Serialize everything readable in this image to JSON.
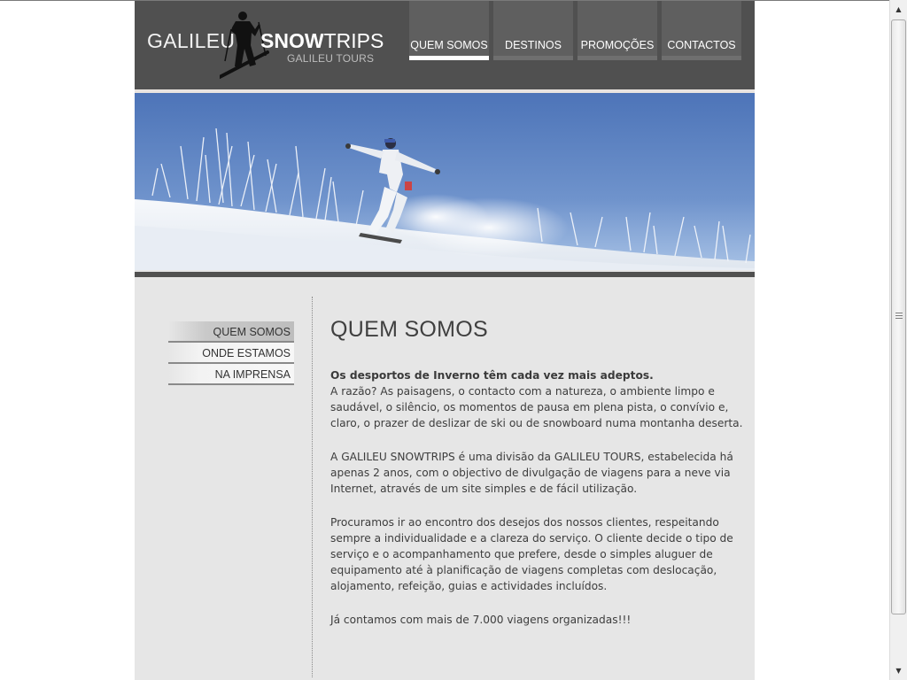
{
  "logo": {
    "word1": "GALILEU",
    "word2_bold": "SNOW",
    "word2_light": "TRIPS",
    "subtitle": "GALILEU TOURS"
  },
  "nav": {
    "items": [
      {
        "label": "QUEM SOMOS",
        "active": true
      },
      {
        "label": "DESTINOS",
        "active": false
      },
      {
        "label": "PROMOÇÕES",
        "active": false
      },
      {
        "label": "CONTACTOS",
        "active": false
      }
    ]
  },
  "hero": {
    "icon": "snowboarder-photo"
  },
  "sidebar": {
    "items": [
      {
        "label": "QUEM SOMOS",
        "active": true
      },
      {
        "label": "ONDE ESTAMOS",
        "active": false
      },
      {
        "label": "NA IMPRENSA",
        "active": false
      }
    ]
  },
  "content": {
    "title": "QUEM SOMOS",
    "lead_bold": "Os desportos de Inverno têm cada vez mais adeptos.",
    "p1": "A razão? As paisagens, o contacto com a natureza, o ambiente limpo e saudável, o silêncio, os momentos de pausa em plena pista, o convívio e, claro, o prazer de deslizar de ski ou de snowboard numa montanha deserta.",
    "p2": "A GALILEU SNOWTRIPS é uma divisão da GALILEU TOURS, estabelecida há apenas 2 anos, com o objectivo de divulgação de viagens para a neve via Internet, através de um site simples e de fácil utilização.",
    "p3": "Procuramos ir ao encontro dos desejos dos nossos clientes, respeitando sempre a individualidade e a clareza do serviço. O cliente decide o tipo de serviço e o acompanhamento que prefere, desde o simples aluguer de equipamento até à planificação de viagens completas com deslocação, alojamento, refeição, guias e actividades incluídos.",
    "p4": "Já contamos com mais de 7.000 viagens organizadas!!!"
  },
  "colors": {
    "header_bg": "#505050",
    "nav_tab": "#5f5f5f",
    "page_bg": "#e6e6e6",
    "text": "#3d3d3d"
  }
}
